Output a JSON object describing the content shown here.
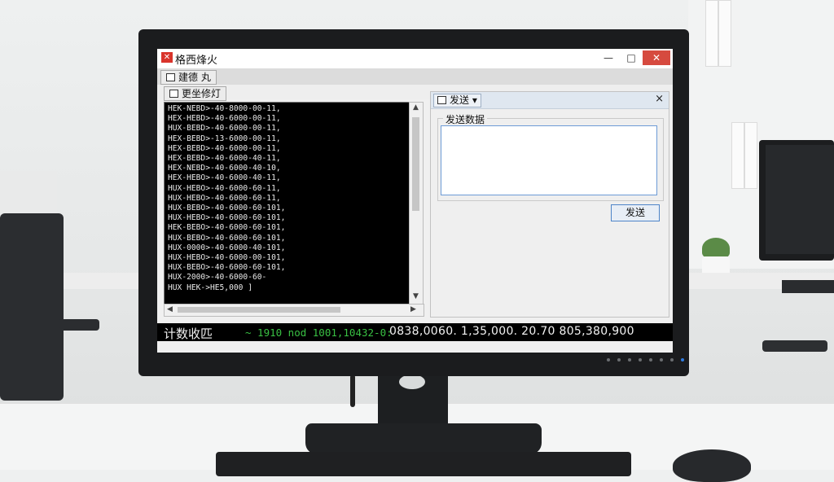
{
  "window": {
    "title": "格西烽火",
    "controls": {
      "minimize": "—",
      "maximize": "□",
      "close": "✕"
    }
  },
  "toolbar": {
    "button1_label": "建德 丸",
    "button2_label": "更坐修灯"
  },
  "terminal": {
    "lines": [
      "HEK-NEBD>-40-8000-00-11,",
      "HEX-HEBD>-40-6000-00-11,",
      "HUX-BEBD>-40-6000-00-11,",
      "HEX-BEBD>-13-6000-00-11,",
      "HEX-BEBD>-40-6000-00-11,",
      "HEX-BEBD>-40-6000-40-11,",
      "HEX-NEBD>-40-6000-40-10,",
      "HEX-HEBO>-40-6000-40-11,",
      "HUX-HEBO>-40-6000-60-11,",
      "HUX-HEBO>-40-6000-60-11,",
      "HUX-BEBO>-40-6000-60-101,",
      "HUX-HEBO>-40-6000-60-101,",
      "HEK-BEBO>-40-6000-60-101,",
      "HUX-BEBO>-40-6000-60-101,",
      "HUX-0000>-40-6000-40-101,",
      "HUX-HEBO>-40-6000-00-101,",
      "HUX-BEBO>-40-6000-60-101,",
      "HUX-2000>-40-6000-60-",
      "HUX HEK->HE5,000 ]"
    ]
  },
  "send_panel": {
    "tab_label": "发送",
    "close": "×",
    "group_label": "发送数据",
    "input_value": "",
    "send_button": "发送"
  },
  "status": {
    "label": "计数收匹",
    "green_text": "~ 1910 nod 1001,10432-0:",
    "white_text": "0838,0060. 1,35,000. 20.70   805,380,900"
  }
}
